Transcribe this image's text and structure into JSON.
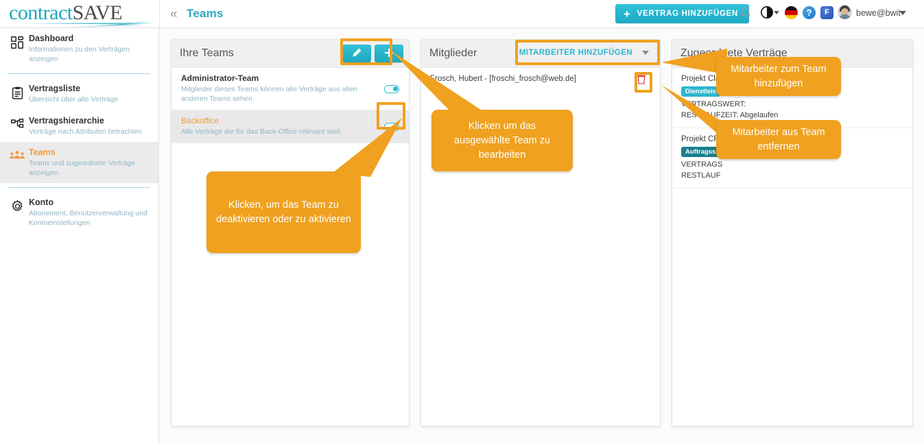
{
  "brand": {
    "part1": "contract",
    "part2": "SAVE"
  },
  "header": {
    "collapse_icon": "«",
    "page_title": "Teams",
    "add_contract_label": "VERTRAG HINZUFÜGEN",
    "add_plus": "+",
    "help_glyph": "?",
    "square_glyph": "F",
    "username": "bewe@bwit",
    "icons": [
      "bell-icon",
      "contrast-icon",
      "flag-de-icon",
      "help-icon",
      "app-icon",
      "avatar"
    ]
  },
  "sidebar": {
    "items": [
      {
        "title": "Dashboard",
        "sub": "Informationen zu den Verträgen anzeigen",
        "icon": "dashboard-icon",
        "active": false
      },
      {
        "title": "Vertragsliste",
        "sub": "Übersicht über alle Verträge",
        "icon": "clipboard-icon",
        "active": false
      },
      {
        "title": "Vertragshierarchie",
        "sub": "Verträge nach Attributen betrachten",
        "icon": "hierarchy-icon",
        "active": false
      },
      {
        "title": "Teams",
        "sub": "Teams und zugeordnete Verträge anzeigen.",
        "icon": "people-icon",
        "active": true
      },
      {
        "title": "Konto",
        "sub": "Abonement, Benutzerverwaltung und Kontoeinstellungen",
        "icon": "gear-icon",
        "active": false
      }
    ]
  },
  "teams_panel": {
    "title": "Ihre Teams",
    "edit_button_icon": "pencil-icon",
    "add_button_icon": "plus-icon",
    "rows": [
      {
        "name": "Administrator-Team",
        "desc": "Mitglieder dieses Teams können alle Verträge aus allen anderen Teams sehen",
        "selected": false,
        "toggle_on": true
      },
      {
        "name": "Backoffice",
        "desc": "Alle Verträge die für das Back-Office relevant sind.",
        "selected": true,
        "toggle_on": true
      }
    ]
  },
  "members_panel": {
    "title": "Mitglieder",
    "add_member_label": "MITARBEITER HINZUFÜGEN",
    "rows": [
      {
        "text": "Frosch, Hubert - [froschi_frosch@web.de]",
        "delete_icon": "trash-icon"
      }
    ]
  },
  "contracts_panel": {
    "title": "Zugeordnete Verträge",
    "rows": [
      {
        "title": "Projekt Cla",
        "badge": "Dienstleis",
        "badge_color": "#2db6cf",
        "line1": "VERTRAGSWERT:",
        "line2": "RESTLAUFZEIT: Abgelaufen"
      },
      {
        "title": "Projekt CR",
        "badge": "Auftragss",
        "badge_color": "#1a7f8f",
        "line1": "VERTRAGS",
        "line2": "RESTLAUF"
      }
    ]
  },
  "annotations": {
    "accent_color": "#efa11f",
    "callouts": [
      {
        "id": "callout-activate",
        "text": "Klicken, um das Team zu deaktivieren oder zu aktivieren"
      },
      {
        "id": "callout-edit",
        "text": "Klicken um das ausgewählte Team zu bearbeiten"
      },
      {
        "id": "callout-add-member",
        "text": "Mitarbeiter zum Team hinzufügen"
      },
      {
        "id": "callout-remove-member",
        "text": "Mitarbeiter aus Team entfernen"
      }
    ]
  }
}
